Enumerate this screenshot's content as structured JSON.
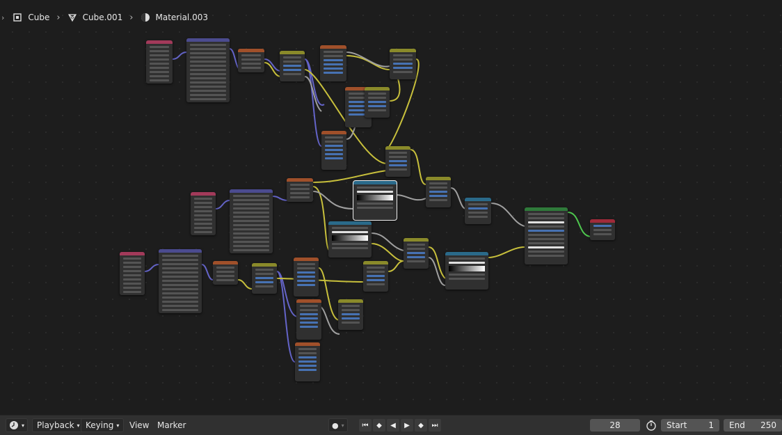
{
  "breadcrumb": {
    "object": "Cube",
    "mesh": "Cube.001",
    "material": "Material.003",
    "separator": "›"
  },
  "timeline": {
    "menus": [
      "Playback",
      "Keying",
      "View",
      "Marker"
    ],
    "current_frame": "28",
    "start_label": "Start",
    "start_value": "1",
    "end_label": "End",
    "end_value": "250"
  },
  "icons": {
    "editor_type": "clock-icon",
    "record": "record-icon",
    "jump_start": "jump-start-icon",
    "prev_keyframe": "prev-keyframe-icon",
    "play_reverse": "play-reverse-icon",
    "play": "play-icon",
    "next_keyframe": "next-keyframe-icon",
    "jump_end": "jump-end-icon",
    "stopwatch": "stopwatch-icon"
  },
  "colors": {
    "texcoord_header": "#a23a5a",
    "mapping_header": "#4b4b8f",
    "math_header": "#8a8a2a",
    "texture_header": "#a0502a",
    "colorramp_header": "#2a6a8a",
    "shader_header": "#2f7a3a",
    "output_header": "#a02a3a",
    "wire_yellow": "#c8c03c",
    "wire_grey": "#a0a0a0",
    "wire_purple": "#6464c8",
    "wire_green": "#4ec84e"
  }
}
